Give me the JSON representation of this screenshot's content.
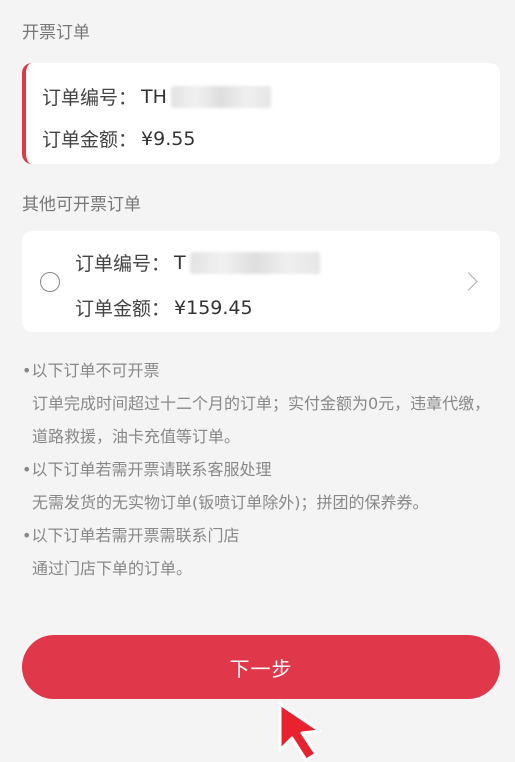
{
  "header": {
    "invoice_orders_title": "开票订单",
    "other_orders_title": "其他可开票订单"
  },
  "selected_order": {
    "order_no_label": "订单编号：",
    "order_no_value": "TH",
    "amount_label": "订单金额：",
    "amount_value": "¥9.55"
  },
  "other_order": {
    "order_no_label": "订单编号：",
    "order_no_value": "T",
    "amount_label": "订单金额：",
    "amount_value": "¥159.45"
  },
  "notes": [
    {
      "head": "•以下订单不可开票",
      "body": "订单完成时间超过十二个月的订单；实付金额为0元，违章代缴，道路救援，油卡充值等订单。"
    },
    {
      "head": "•以下订单若需开票请联系客服处理",
      "body": "无需发货的无实物订单(钣喷订单除外)；拼团的保养券。"
    },
    {
      "head": "•以下订单若需开票需联系门店",
      "body": "通过门店下单的订单。"
    }
  ],
  "next_button": {
    "label": "下一步"
  },
  "colors": {
    "accent": "#e0374a",
    "background": "#f4f4f4"
  }
}
